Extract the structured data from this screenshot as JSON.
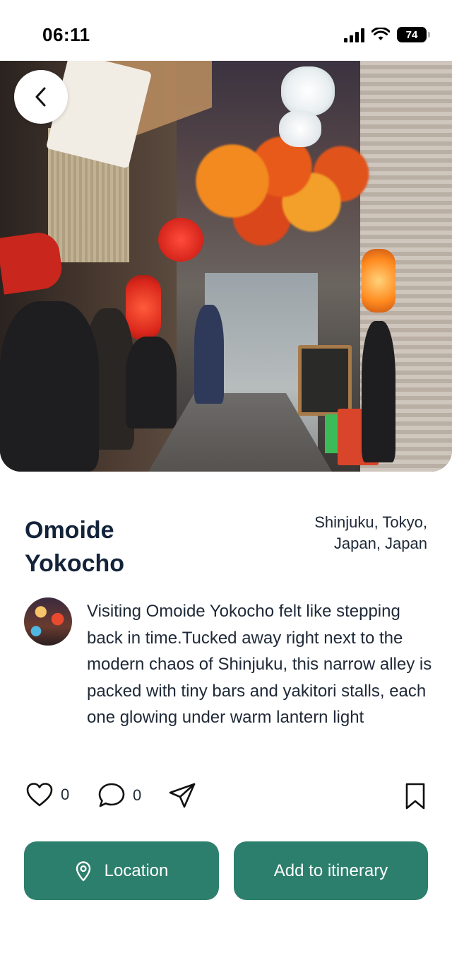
{
  "status_bar": {
    "time": "06:11",
    "battery": "74"
  },
  "place": {
    "title": "Omoide Yokocho",
    "location": "Shinjuku, Tokyo, Japan, Japan"
  },
  "post": {
    "description": "Visiting Omoide Yokocho felt like stepping back in time.Tucked away right next to the modern chaos of Shinjuku, this narrow alley is packed with tiny bars and yakitori stalls, each one glowing under warm lantern light"
  },
  "actions": {
    "likes": "0",
    "comments": "0"
  },
  "buttons": {
    "location_label": "Location",
    "itinerary_label": "Add to itinerary"
  },
  "colors": {
    "accent": "#2c7f6c",
    "title": "#13233a"
  },
  "icons": [
    "back-icon",
    "heart-icon",
    "comment-icon",
    "share-icon",
    "bookmark-icon",
    "location-pin-icon"
  ]
}
